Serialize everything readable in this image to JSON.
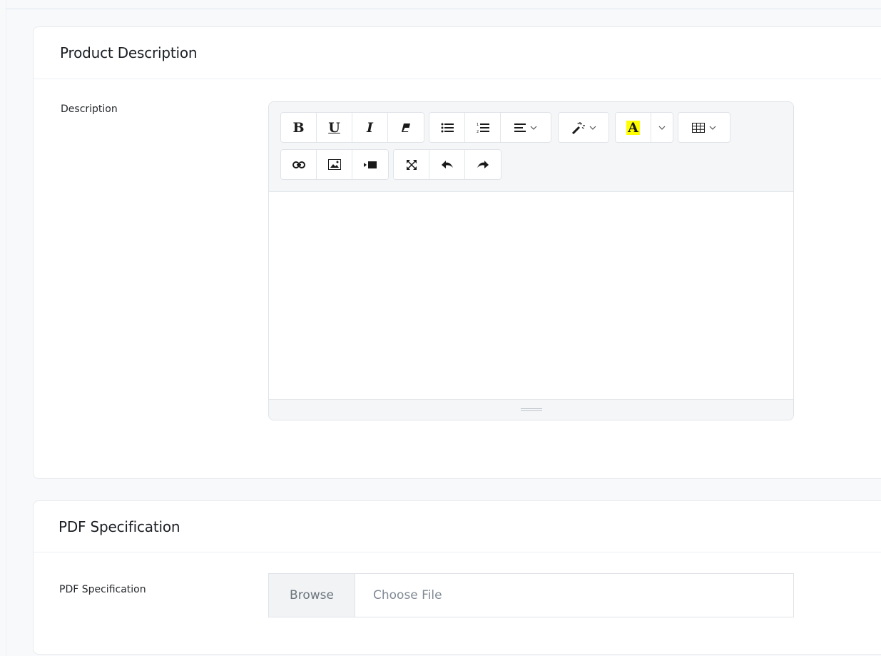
{
  "product_description": {
    "title": "Product Description",
    "field_label": "Description",
    "toolbar": {
      "bold": "B",
      "underline": "U",
      "italic": "I",
      "highlight_letter": "A"
    }
  },
  "pdf_specification": {
    "title": "PDF Specification",
    "field_label": "PDF Specification",
    "browse_label": "Browse",
    "file_placeholder": "Choose File"
  },
  "colors": {
    "highlight": "#ffff00"
  }
}
